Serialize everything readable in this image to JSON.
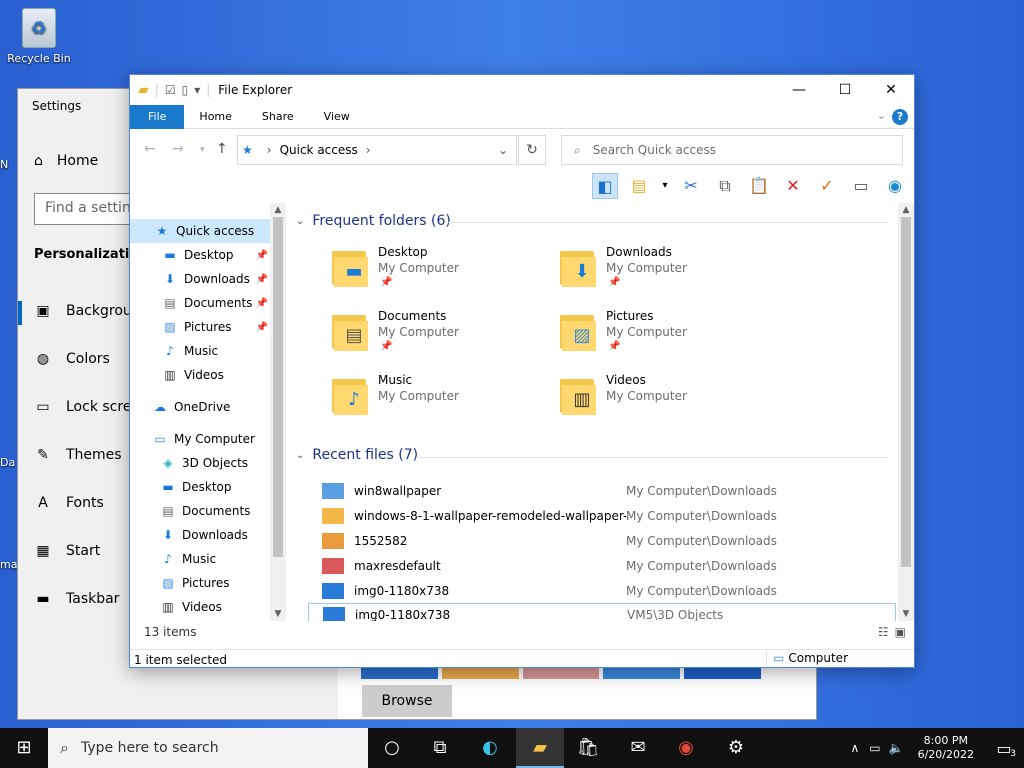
{
  "desktop": {
    "recycle_bin": "Recycle Bin",
    "edge_labels": [
      "N",
      "Da",
      "ma"
    ]
  },
  "settings": {
    "title": "Settings",
    "home": "Home",
    "search_placeholder": "Find a setting",
    "section": "Personalization",
    "items": [
      {
        "label": "Background",
        "icon": "image-icon"
      },
      {
        "label": "Colors",
        "icon": "palette-icon"
      },
      {
        "label": "Lock screen",
        "icon": "lock-screen-icon"
      },
      {
        "label": "Themes",
        "icon": "themes-icon"
      },
      {
        "label": "Fonts",
        "icon": "fonts-icon"
      },
      {
        "label": "Start",
        "icon": "start-icon"
      },
      {
        "label": "Taskbar",
        "icon": "taskbar-icon"
      }
    ],
    "browse": "Browse"
  },
  "explorer": {
    "title": "File Explorer",
    "tabs": [
      "File",
      "Home",
      "Share",
      "View"
    ],
    "address": "Quick access",
    "search_placeholder": "Search Quick access",
    "nav": [
      {
        "label": "Quick access",
        "icon": "star",
        "pinned": false
      },
      {
        "label": "Desktop",
        "icon": "desktop",
        "pinned": true
      },
      {
        "label": "Downloads",
        "icon": "down",
        "pinned": true
      },
      {
        "label": "Documents",
        "icon": "doc",
        "pinned": true
      },
      {
        "label": "Pictures",
        "icon": "pic",
        "pinned": true
      },
      {
        "label": "Music",
        "icon": "music",
        "pinned": false
      },
      {
        "label": "Videos",
        "icon": "video",
        "pinned": false
      },
      {
        "label": "OneDrive",
        "icon": "cloud",
        "pinned": false
      },
      {
        "label": "My Computer",
        "icon": "pc",
        "pinned": false
      },
      {
        "label": "3D Objects",
        "icon": "cube",
        "pinned": false
      },
      {
        "label": "Desktop",
        "icon": "desktop",
        "pinned": false
      },
      {
        "label": "Documents",
        "icon": "doc",
        "pinned": false
      },
      {
        "label": "Downloads",
        "icon": "down",
        "pinned": false
      },
      {
        "label": "Music",
        "icon": "music",
        "pinned": false
      },
      {
        "label": "Pictures",
        "icon": "pic",
        "pinned": false
      },
      {
        "label": "Videos",
        "icon": "video",
        "pinned": false
      }
    ],
    "frequent_header": "Frequent folders (6)",
    "folders": [
      {
        "name": "Desktop",
        "sub": "My Computer",
        "pinned": true,
        "badge": "🖥"
      },
      {
        "name": "Downloads",
        "sub": "My Computer",
        "pinned": true,
        "badge": "⬇"
      },
      {
        "name": "Documents",
        "sub": "My Computer",
        "pinned": true,
        "badge": "📄"
      },
      {
        "name": "Pictures",
        "sub": "My Computer",
        "pinned": true,
        "badge": "🏞"
      },
      {
        "name": "Music",
        "sub": "My Computer",
        "pinned": false,
        "badge": "♪"
      },
      {
        "name": "Videos",
        "sub": "My Computer",
        "pinned": false,
        "badge": "🎞"
      }
    ],
    "recent_header": "Recent files (7)",
    "recent": [
      {
        "name": "win8wallpaper",
        "path": "My Computer\\Downloads",
        "color": "#5aa0e0"
      },
      {
        "name": "windows-8-1-wallpaper-remodeled-wallpaper-...",
        "path": "My Computer\\Downloads",
        "color": "#f2b84a"
      },
      {
        "name": "1552582",
        "path": "My Computer\\Downloads",
        "color": "#e89a3c"
      },
      {
        "name": "maxresdefault",
        "path": "My Computer\\Downloads",
        "color": "#d85a5a"
      },
      {
        "name": "img0-1180x738",
        "path": "My Computer\\Downloads",
        "color": "#2a7ad8"
      },
      {
        "name": "img0-1180x738",
        "path": "VM5\\3D Objects",
        "color": "#2a7ad8"
      }
    ],
    "item_count": "13 items",
    "status": "1 item selected",
    "status_location": "Computer"
  },
  "taskbar": {
    "search_placeholder": "Type here to search",
    "time": "8:00 PM",
    "date": "6/20/2022",
    "notification_count": "3"
  }
}
